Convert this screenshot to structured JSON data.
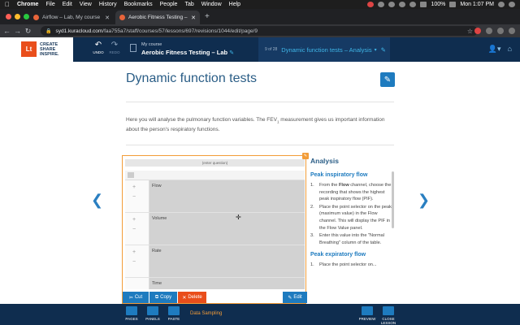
{
  "menubar": {
    "app": "Chrome",
    "items": [
      "File",
      "Edit",
      "View",
      "History",
      "Bookmarks",
      "People",
      "Tab",
      "Window",
      "Help"
    ],
    "battery": "100%",
    "clock": "Mon 1:07 PM"
  },
  "browser": {
    "tabs": [
      {
        "title": "Airflow – Lab, My course",
        "active": false
      },
      {
        "title": "Aerobic Fitness Testing – Lab...",
        "active": true
      }
    ],
    "url_host": "syd1.kuracloud.com",
    "url_path": "/faa755a7/staff/courses/57/lessons/697/revisions/1044/edit/page/9"
  },
  "header": {
    "logo_mark": "Lt",
    "logo_lines": [
      "CREATE",
      "SHARE",
      "INSPIRE."
    ],
    "undo_label": "UNDO",
    "redo_label": "REDO",
    "course_label": "My course",
    "course_name": "Aerobic Fitness Testing – Lab",
    "page_counter": "9 of 28",
    "page_title": "Dynamic function tests – Analysis"
  },
  "content": {
    "title": "Dynamic function tests",
    "intro_before": "Here you will analyse the pulmonary function variables. The FEV",
    "intro_sub": "1",
    "intro_after": " measurement gives us important information about the person's respiratory functions."
  },
  "widget": {
    "question_placeholder": "(enter question)",
    "channels": [
      "Flow",
      "Volume",
      "Rate",
      "Time"
    ],
    "buttons": {
      "cut": "Cut",
      "copy": "Copy",
      "delete": "Delete",
      "edit": "Edit"
    }
  },
  "analysis": {
    "heading": "Analysis",
    "sections": [
      {
        "title": "Peak inspiratory flow",
        "steps": [
          {
            "num": "1.",
            "before": "From the ",
            "bold": "Flow",
            "after": " channel, choose the recording that shows the highest peak inspiratory flow (PIF)."
          },
          {
            "num": "2.",
            "before": "Place the point selector on the peak (maximum value) in the Flow channel. This will display the PIF in the Flow Value panel.",
            "bold": "",
            "after": ""
          },
          {
            "num": "3.",
            "before": "Enter this value into the \"Normal Breathing\" column of the table.",
            "bold": "",
            "after": ""
          }
        ]
      },
      {
        "title": "Peak expiratory flow",
        "steps": [
          {
            "num": "1.",
            "before": "Place the point selector on...",
            "bold": "",
            "after": ""
          }
        ]
      }
    ]
  },
  "bottombar": {
    "pages": "PAGES",
    "panels": "PANELS",
    "paste": "PASTE",
    "data_sampling": "Data Sampling",
    "preview": "PREVIEW",
    "close_lesson": "CLOSE LESSON"
  },
  "colors": {
    "navy": "#0f2d4f",
    "accent_blue": "#1e7bbf",
    "orange": "#e94e1b",
    "highlight": "#f29c38"
  }
}
